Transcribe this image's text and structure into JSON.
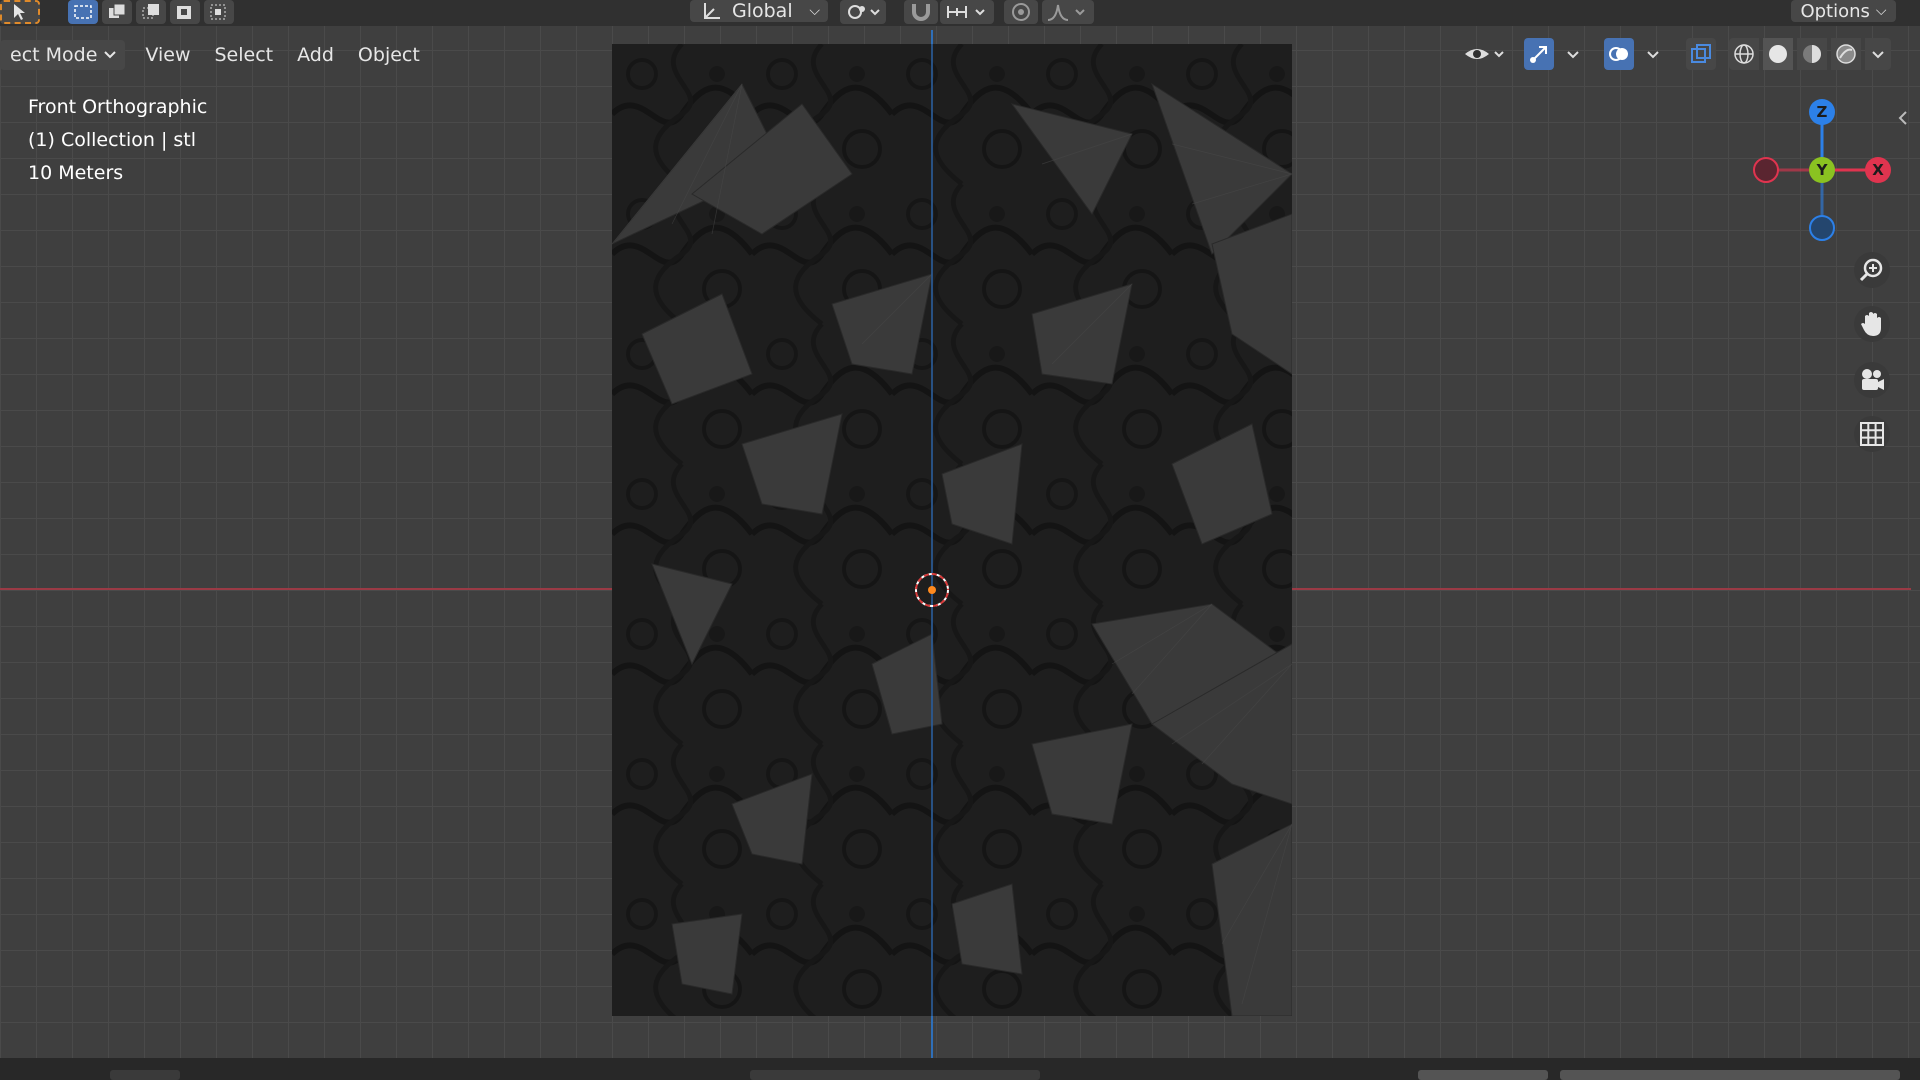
{
  "header": {
    "mode_label": "ect Mode",
    "menus": [
      "View",
      "Select",
      "Add",
      "Object"
    ],
    "transform_orientation": "Global",
    "options_label": "Options"
  },
  "viewport_info": {
    "view_name": "Front Orthographic",
    "collection": "(1) Collection | stl",
    "scale": "10 Meters"
  },
  "gizmo": {
    "z_label": "Z",
    "y_label": "Y",
    "x_label": "X",
    "colors": {
      "x": "#e0344f",
      "y": "#8ac221",
      "z": "#2c80e8"
    }
  },
  "nav_buttons": [
    "zoom-icon",
    "hand-pan-icon",
    "camera-icon",
    "grid-icon"
  ],
  "colors": {
    "accent": "#4772b3",
    "viewport_bg": "#3f3f3f",
    "mesh_dark": "#1c1c1c",
    "origin": "#ff8a1f"
  }
}
